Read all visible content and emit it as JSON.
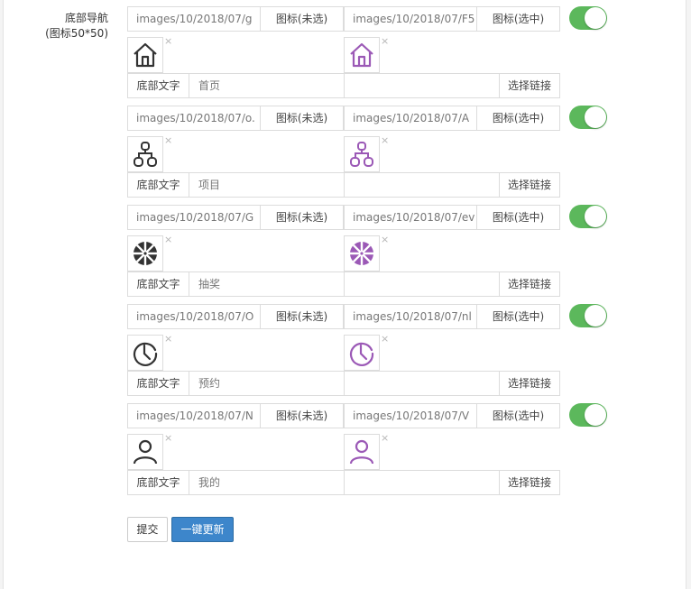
{
  "form": {
    "label_line1": "底部导航",
    "label_line2": "(图标50*50)",
    "addon_unselected": "图标(未选)",
    "addon_selected": "图标(选中)",
    "text_addon": "底部文字",
    "link_button": "选择链接",
    "remove_symbol": "×",
    "selected_icon_color": "#9b59b6",
    "unselected_icon_color": "#333333",
    "toggle_color": "#5cb85c"
  },
  "nav_items": [
    {
      "icon": "home-icon",
      "path_unselected": "images/10/2018/07/g",
      "path_selected": "images/10/2018/07/F5",
      "text": "首页",
      "link": "",
      "enabled": true
    },
    {
      "icon": "nodes-icon",
      "path_unselected": "images/10/2018/07/o.",
      "path_selected": "images/10/2018/07/A",
      "text": "项目",
      "link": "",
      "enabled": true
    },
    {
      "icon": "wheel-icon",
      "path_unselected": "images/10/2018/07/G",
      "path_selected": "images/10/2018/07/ev",
      "text": "抽奖",
      "link": "",
      "enabled": true
    },
    {
      "icon": "clock-icon",
      "path_unselected": "images/10/2018/07/O",
      "path_selected": "images/10/2018/07/nl",
      "text": "预约",
      "link": "",
      "enabled": true
    },
    {
      "icon": "user-icon",
      "path_unselected": "images/10/2018/07/N",
      "path_selected": "images/10/2018/07/V",
      "text": "我的",
      "link": "",
      "enabled": true
    }
  ],
  "buttons": {
    "submit": "提交",
    "one_click_update": "一键更新"
  }
}
